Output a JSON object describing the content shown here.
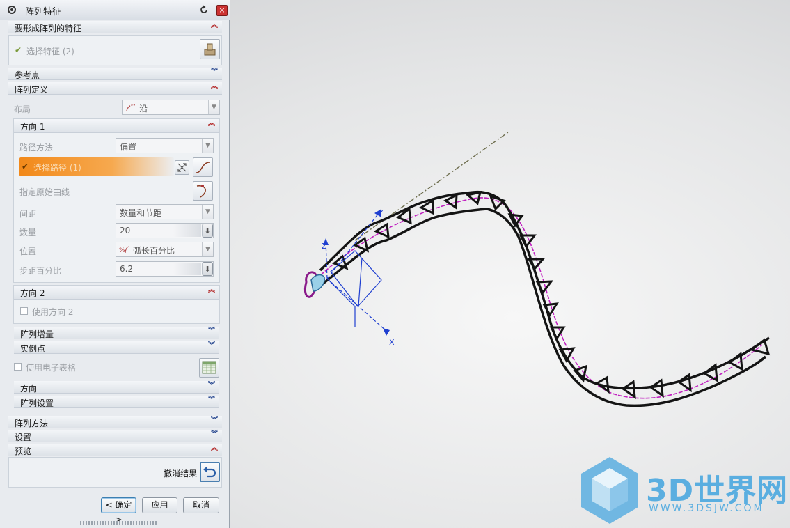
{
  "dialog": {
    "title": "阵列特征",
    "close_glyph": "×",
    "sections": {
      "features_to_pattern": "要形成阵列的特征",
      "reference_point": "参考点",
      "pattern_definition": "阵列定义",
      "pattern_increment": "阵列增量",
      "instance_points": "实例点",
      "orientation": "方向",
      "pattern_settings": "阵列设置",
      "pattern_method": "阵列方法",
      "settings": "设置",
      "preview": "预览"
    },
    "select_feature_label": "选择特征 (2)",
    "layout_label": "布局",
    "layout_value": "沿",
    "direction1": {
      "title": "方向 1",
      "path_method_label": "路径方法",
      "path_method_value": "偏置",
      "select_path_label": "选择路径 (1)",
      "specify_curve_label": "指定原始曲线",
      "spacing_label": "间距",
      "spacing_value": "数量和节距",
      "count_label": "数量",
      "count_value": "20",
      "position_label": "位置",
      "position_value": "弧长百分比",
      "step_percent_label": "步距百分比",
      "step_percent_value": "6.2"
    },
    "direction2": {
      "title": "方向 2",
      "use_direction2_label": "使用方向 2"
    },
    "use_spreadsheet_label": "使用电子表格",
    "undo_result_label": "撤消结果",
    "buttons": {
      "ok": "< 确定 >",
      "apply": "应用",
      "cancel": "取消"
    },
    "checkmark_glyph": "✔",
    "down_arrow_glyph": "▼",
    "spinner_glyph": "⬇"
  },
  "viewport": {
    "axis_labels": {
      "x": "X",
      "y": "Y",
      "z": "Z"
    }
  },
  "watermark": {
    "brand": "3D世界网",
    "url": "WWW.3DSJW.COM"
  },
  "colors": {
    "accent_orange": "#f2891a",
    "path_curve": "#c020c0",
    "csys_blue": "#1f3fd0",
    "logo_blue": "#5aaee0"
  },
  "icons": [
    "settings-icon",
    "reset-icon",
    "close-icon",
    "feature-select-icon",
    "curve-icon",
    "swap-icon",
    "spreadsheet-icon",
    "undo-icon"
  ]
}
